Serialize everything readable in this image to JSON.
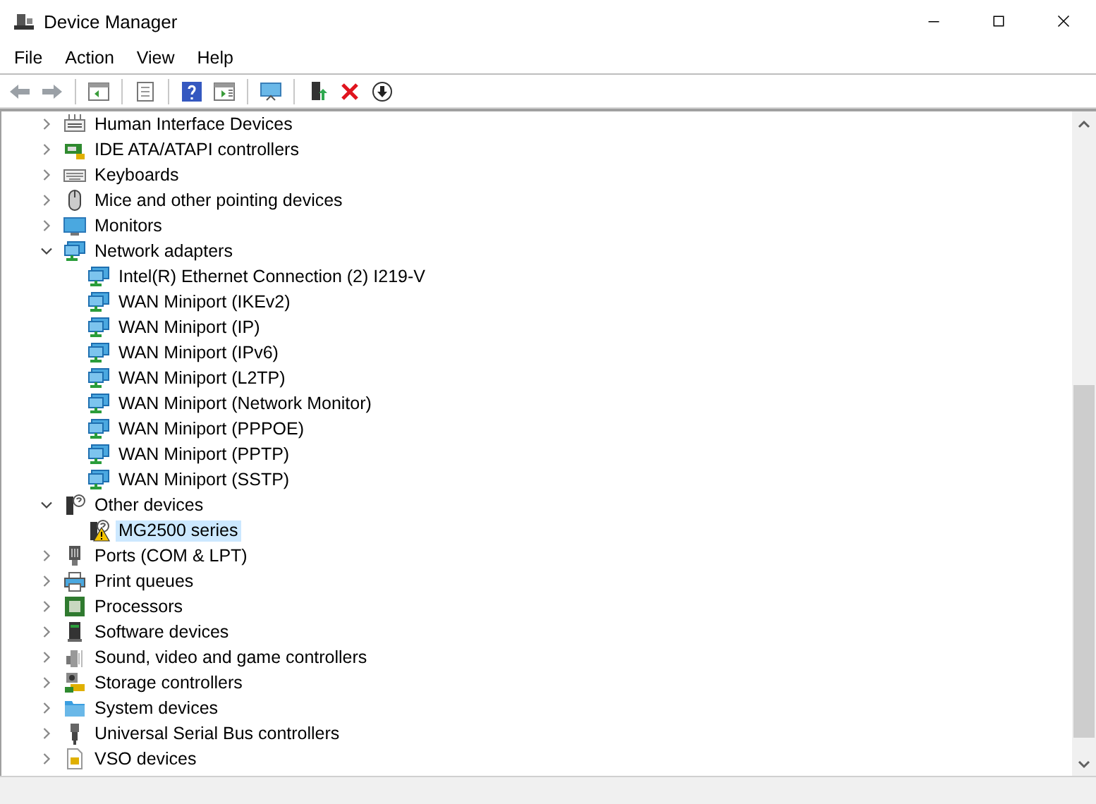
{
  "window": {
    "title": "Device Manager"
  },
  "menu": [
    "File",
    "Action",
    "View",
    "Help"
  ],
  "tree": [
    {
      "label": "Human Interface Devices",
      "expanded": false,
      "selected": false
    },
    {
      "label": "IDE ATA/ATAPI controllers",
      "expanded": false,
      "selected": false
    },
    {
      "label": "Keyboards",
      "expanded": false,
      "selected": false
    },
    {
      "label": "Mice and other pointing devices",
      "expanded": false,
      "selected": false
    },
    {
      "label": "Monitors",
      "expanded": false,
      "selected": false
    },
    {
      "label": "Network adapters",
      "expanded": true,
      "selected": false,
      "children": [
        {
          "label": "Intel(R) Ethernet Connection (2) I219-V",
          "selected": false,
          "warning": false
        },
        {
          "label": "WAN Miniport (IKEv2)",
          "selected": false,
          "warning": false
        },
        {
          "label": "WAN Miniport (IP)",
          "selected": false,
          "warning": false
        },
        {
          "label": "WAN Miniport (IPv6)",
          "selected": false,
          "warning": false
        },
        {
          "label": "WAN Miniport (L2TP)",
          "selected": false,
          "warning": false
        },
        {
          "label": "WAN Miniport (Network Monitor)",
          "selected": false,
          "warning": false
        },
        {
          "label": "WAN Miniport (PPPOE)",
          "selected": false,
          "warning": false
        },
        {
          "label": "WAN Miniport (PPTP)",
          "selected": false,
          "warning": false
        },
        {
          "label": "WAN Miniport (SSTP)",
          "selected": false,
          "warning": false
        }
      ]
    },
    {
      "label": "Other devices",
      "expanded": true,
      "selected": false,
      "children": [
        {
          "label": "MG2500 series",
          "selected": true,
          "warning": true
        }
      ]
    },
    {
      "label": "Ports (COM & LPT)",
      "expanded": false,
      "selected": false
    },
    {
      "label": "Print queues",
      "expanded": false,
      "selected": false
    },
    {
      "label": "Processors",
      "expanded": false,
      "selected": false
    },
    {
      "label": "Software devices",
      "expanded": false,
      "selected": false
    },
    {
      "label": "Sound, video and game controllers",
      "expanded": false,
      "selected": false
    },
    {
      "label": "Storage controllers",
      "expanded": false,
      "selected": false
    },
    {
      "label": "System devices",
      "expanded": false,
      "selected": false
    },
    {
      "label": "Universal Serial Bus controllers",
      "expanded": false,
      "selected": false
    },
    {
      "label": "VSO devices",
      "expanded": false,
      "selected": false
    }
  ]
}
